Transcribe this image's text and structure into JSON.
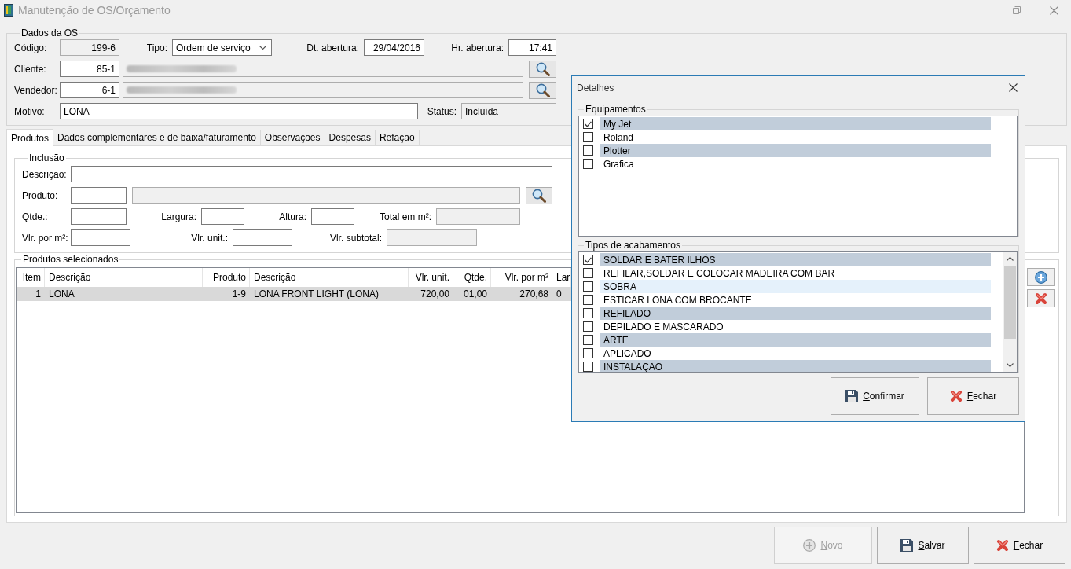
{
  "window": {
    "title": "Manutenção de OS/Orçamento"
  },
  "os_data": {
    "title": "Dados da OS",
    "code": {
      "label": "Código:",
      "value": "199-6",
      "readonly": true
    },
    "type": {
      "label": "Tipo:",
      "value": "Ordem de serviço"
    },
    "open_date": {
      "label": "Dt. abertura:",
      "value": "29/04/2016",
      "readonly": false
    },
    "open_time": {
      "label": "Hr. abertura:",
      "value": "17:41",
      "readonly": false
    },
    "client": {
      "label": "Cliente:",
      "value": "85-1",
      "readonly": false,
      "name_readonly": true,
      "name_blurred": true
    },
    "seller": {
      "label": "Vendedor:",
      "value": "6-1",
      "readonly": false,
      "name_readonly": true,
      "name_blurred": true
    },
    "reason": {
      "label": "Motivo:",
      "value": "LONA",
      "readonly": false
    },
    "status": {
      "label": "Status:",
      "value": "Incluída",
      "readonly": true
    }
  },
  "tabs": [
    {
      "label": "Produtos",
      "selected": true
    },
    {
      "label": "Dados complementares e de baixa/faturamento",
      "selected": false
    },
    {
      "label": "Observações",
      "selected": false
    },
    {
      "label": "Despesas",
      "selected": false
    },
    {
      "label": "Refação",
      "selected": false
    }
  ],
  "inclusion": {
    "title": "Inclusão",
    "description": {
      "label": "Descrição:",
      "readonly": false
    },
    "product": {
      "label": "Produto:",
      "readonly": false,
      "name_readonly": true
    },
    "quantity": {
      "label": "Qtde.:",
      "readonly": false
    },
    "width": {
      "label": "Largura:",
      "readonly": false
    },
    "height": {
      "label": "Altura:",
      "readonly": false
    },
    "total_area": {
      "label": "Total em m²:",
      "readonly": true
    },
    "price_per_m2": {
      "label": "Vlr. por m²:",
      "readonly": false
    },
    "unit_price": {
      "label": "Vlr. unit.:",
      "readonly": false
    },
    "subtotal": {
      "label": "Vlr. subtotal:",
      "readonly": true
    }
  },
  "selected_products": {
    "title": "Produtos selecionados",
    "table": {
      "columns": [
        {
          "label": "Item",
          "kind": "number"
        },
        {
          "label": "Descrição",
          "kind": "text"
        },
        {
          "label": "Produto",
          "kind": "number"
        },
        {
          "label": "Descrição",
          "kind": "text"
        },
        {
          "label": "Vlr. unit.",
          "kind": "number"
        },
        {
          "label": "Qtde.",
          "kind": "number"
        },
        {
          "label": "Vlr. por m²",
          "kind": "number"
        },
        {
          "label": "Lar",
          "kind": "text"
        }
      ],
      "rows": [
        {
          "selected": true,
          "cells": [
            "1",
            "LONA",
            "1-9",
            "LONA FRONT LIGHT (LONA)",
            "720,00",
            "01,00",
            "270,68",
            "0"
          ]
        }
      ]
    },
    "row_actions": [
      {
        "kind": "add"
      },
      {
        "kind": "remove"
      }
    ]
  },
  "buttons": [
    {
      "label": "Novo",
      "kind": "new",
      "disabled": true,
      "mnemonic": true
    },
    {
      "label": "Salvar",
      "kind": "save",
      "disabled": false,
      "mnemonic": true
    },
    {
      "label": "Fechar",
      "kind": "close",
      "disabled": false,
      "mnemonic": true
    }
  ],
  "dialog": {
    "title": "Detalhes",
    "equipment": {
      "title": "Equipamentos",
      "items": [
        {
          "label": "My Jet",
          "checked": true
        },
        {
          "label": "Roland",
          "checked": false
        },
        {
          "label": "Plotter",
          "checked": false
        },
        {
          "label": "Grafica",
          "checked": false
        }
      ]
    },
    "finishes": {
      "title": "Tipos de acabamentos",
      "items": [
        {
          "label": "SOLDAR E BATER ILHÓS",
          "checked": true,
          "hovered": false
        },
        {
          "label": "REFILAR,SOLDAR E COLOCAR MADEIRA COM BAR",
          "checked": false,
          "hovered": false
        },
        {
          "label": "SOBRA",
          "checked": false,
          "hovered": true
        },
        {
          "label": "ESTICAR LONA COM BROCANTE",
          "checked": false,
          "hovered": false
        },
        {
          "label": "REFILADO",
          "checked": false,
          "hovered": false
        },
        {
          "label": "DEPILADO E MASCARADO",
          "checked": false,
          "hovered": false
        },
        {
          "label": "ARTE",
          "checked": false,
          "hovered": false
        },
        {
          "label": "APLICADO",
          "checked": false,
          "hovered": false
        },
        {
          "label": "INSTALAÇAO",
          "checked": false,
          "hovered": false
        }
      ]
    },
    "buttons": [
      {
        "label": "Confirmar",
        "kind": "save",
        "disabled": false,
        "mnemonic": true
      },
      {
        "label": "Fechar",
        "kind": "close",
        "disabled": false,
        "mnemonic": true
      }
    ]
  }
}
